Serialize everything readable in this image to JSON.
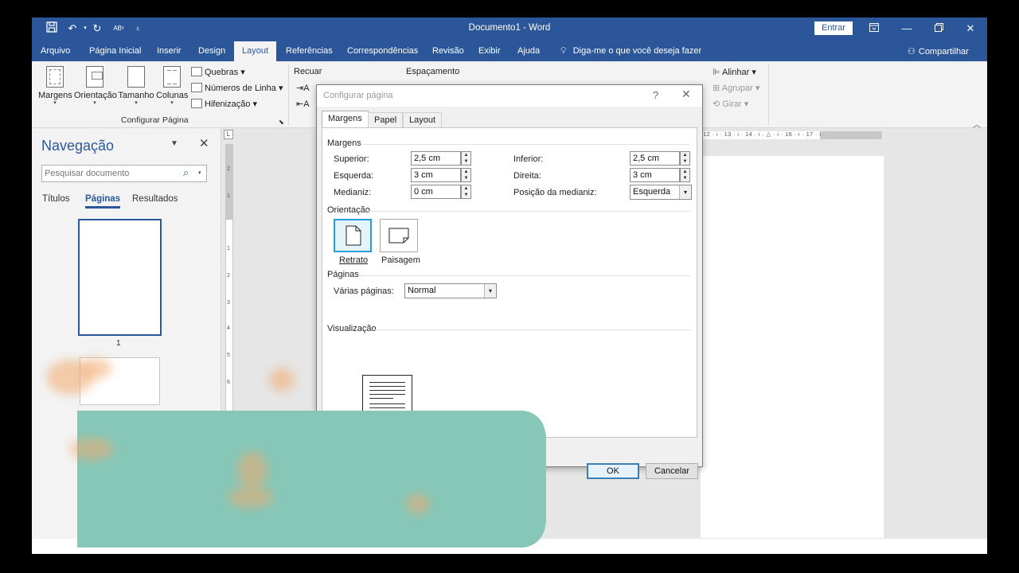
{
  "window": {
    "title": "Documento1 - Word",
    "signin_label": "Entrar",
    "qat_format_label": "AB¹"
  },
  "menu": {
    "tabs": [
      "Arquivo",
      "Página Inicial",
      "Inserir",
      "Design",
      "Layout",
      "Referências",
      "Correspondências",
      "Revisão",
      "Exibir",
      "Ajuda"
    ],
    "active_tab": "Layout",
    "tellme": "Diga-me o que você deseja fazer",
    "share": "Compartilhar"
  },
  "ribbon": {
    "page_setup": {
      "margins": "Margens",
      "orientation": "Orientação",
      "size": "Tamanho",
      "columns": "Colunas",
      "breaks": "Quebras",
      "line_numbers": "Números de Linha",
      "hyphenation": "Hifenização",
      "group_label": "Configurar Página"
    },
    "indent_label": "Recuar",
    "spacing_label": "Espaçamento",
    "arrange": {
      "align": "Alinhar",
      "group": "Agrupar",
      "rotate": "Girar"
    }
  },
  "navigation": {
    "title": "Navegação",
    "search_placeholder": "Pesquisar documento",
    "tabs": [
      "Títulos",
      "Páginas",
      "Resultados"
    ],
    "active_tab": "Páginas",
    "page_number": "1"
  },
  "ruler": {
    "horizontal_ticks": "· 12 · ı · 13 · ı · 14 · ı · △ · ı · 16 · ı · 17 · ı ·",
    "vertical_ticks": [
      "2",
      "1",
      "1",
      "2",
      "3",
      "4",
      "5",
      "6"
    ]
  },
  "dialog": {
    "title": "Configurar página",
    "help": "?",
    "tabs": [
      "Margens",
      "Papel",
      "Layout"
    ],
    "active_tab": "Margens",
    "margins_section": "Margens",
    "top_label": "Superior:",
    "top_value": "2,5 cm",
    "bottom_label": "Inferior:",
    "bottom_value": "2,5 cm",
    "left_label": "Esquerda:",
    "left_value": "3 cm",
    "right_label": "Direita:",
    "right_value": "3 cm",
    "gutter_label": "Medianiz:",
    "gutter_value": "0 cm",
    "gutter_pos_label": "Posição da medianiz:",
    "gutter_pos_value": "Esquerda",
    "orientation_section": "Orientação",
    "portrait": "Retrato",
    "landscape": "Paisagem",
    "selected_orientation": "Retrato",
    "pages_section": "Páginas",
    "multiple_pages_label": "Várias páginas:",
    "multiple_pages_value": "Normal",
    "preview_section": "Visualização",
    "ok": "OK",
    "cancel": "Cancelar"
  },
  "colors": {
    "word_blue": "#2b579a",
    "overlay_teal": "#86c7b8",
    "focus_blue": "#26a0da"
  }
}
